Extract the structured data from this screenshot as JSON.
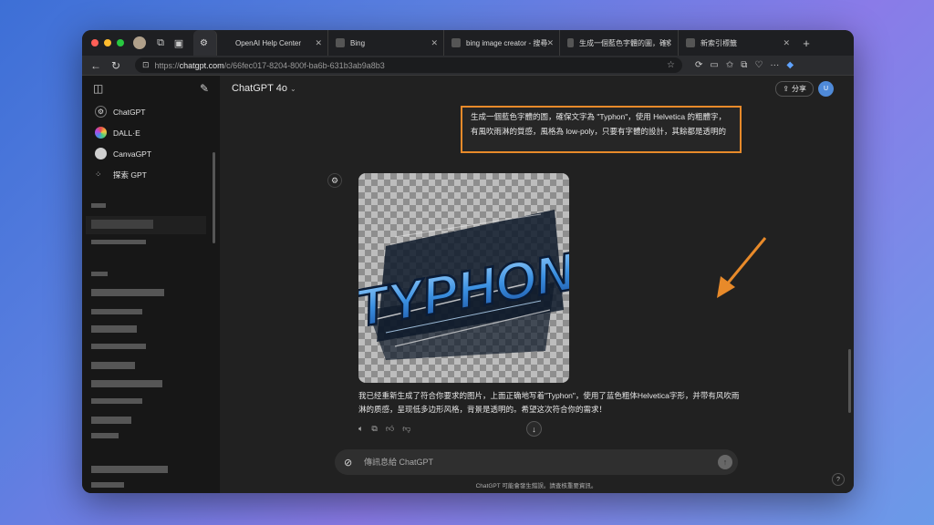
{
  "browser": {
    "tabs": [
      {
        "label": "OpenAI Help Center"
      },
      {
        "label": "Bing"
      },
      {
        "label": "bing image creator - 搜尋"
      },
      {
        "label": "生成一個藍色字體的圖，確保文字為 \"Typho"
      },
      {
        "label": "新索引標籤"
      }
    ],
    "url_prefix": "https://",
    "url_host": "chatgpt.com",
    "url_path": "/c/66fec017-8204-800f-ba6b-631b3ab9a8b3"
  },
  "sidebar": {
    "items": [
      {
        "label": "ChatGPT",
        "icon": "openai-icon"
      },
      {
        "label": "DALL·E",
        "icon": "dalle-icon"
      },
      {
        "label": "CanvaGPT",
        "icon": "canva-icon"
      },
      {
        "label": "探索 GPT",
        "icon": "grid-icon"
      }
    ]
  },
  "header": {
    "model": "ChatGPT 4o",
    "share_label": "分享",
    "avatar_initial": "U"
  },
  "conversation": {
    "user_prompt": "生成一個藍色字體的圖，確保文字為 \"Typhon\"，使用 Helvetica 的粗體字，有風吹雨淋的質感，風格為 low-poly，只要有字體的設計，其餘都是透明的",
    "image_text": "TYPHON",
    "assistant_reply": "我已经重新生成了符合你要求的图片，上面正确地写着\"Typhon\"，使用了蓝色粗体Helvetica字形，并带有风吹雨淋的质感，呈现低多边形风格，背景是透明的。希望这次符合你的需求！"
  },
  "composer": {
    "placeholder": "傳訊息給 ChatGPT"
  },
  "footer": {
    "disclaimer": "ChatGPT 可能會發生錯誤。請查核重要資訊。",
    "help": "?"
  },
  "colors": {
    "accent_orange": "#e88a2a",
    "text_blue": "#3a8fe0"
  }
}
